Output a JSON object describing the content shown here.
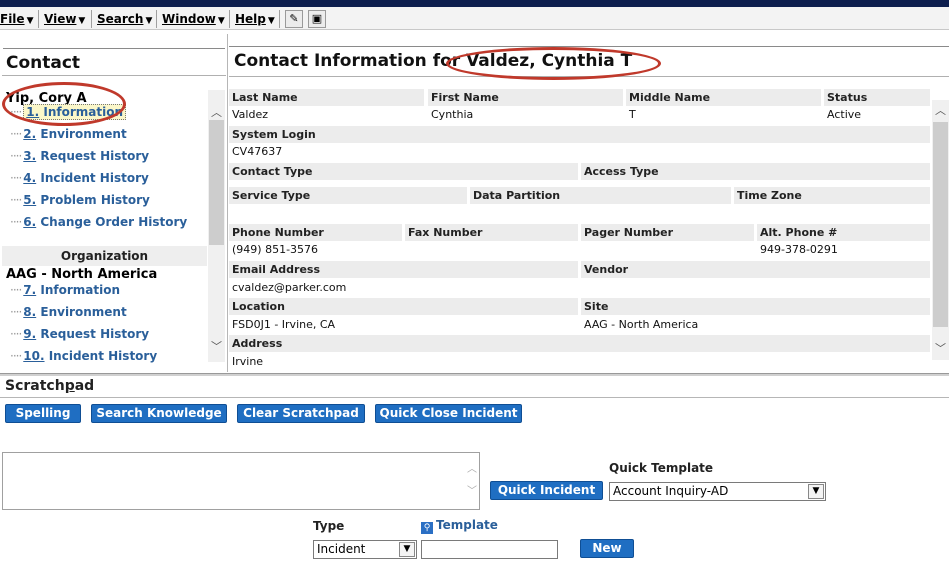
{
  "menu": {
    "file": "File",
    "view": "View",
    "search": "Search",
    "window": "Window",
    "help": "Help"
  },
  "left": {
    "title": "Contact",
    "contact_name": "Yip, Cory A",
    "contact_items": [
      {
        "num": "1.",
        "label": "Information"
      },
      {
        "num": "2.",
        "label": "Environment"
      },
      {
        "num": "3.",
        "label": "Request History"
      },
      {
        "num": "4.",
        "label": "Incident History"
      },
      {
        "num": "5.",
        "label": "Problem History"
      },
      {
        "num": "6.",
        "label": "Change Order History"
      }
    ],
    "org_header": "Organization",
    "org_name": "AAG - North America",
    "org_items": [
      {
        "num": "7.",
        "label": "Information"
      },
      {
        "num": "8.",
        "label": "Environment"
      },
      {
        "num": "9.",
        "label": "Request History"
      },
      {
        "num": "10.",
        "label": "Incident History"
      }
    ]
  },
  "right": {
    "title": "Contact Information for Valdez, Cynthia T",
    "fields": {
      "last_name_label": "Last Name",
      "last_name": "Valdez",
      "first_name_label": "First Name",
      "first_name": "Cynthia",
      "middle_name_label": "Middle Name",
      "middle_name": "T",
      "status_label": "Status",
      "status": "Active",
      "system_login_label": "System Login",
      "system_login": "CV47637",
      "contact_type_label": "Contact Type",
      "access_type_label": "Access Type",
      "service_type_label": "Service Type",
      "data_partition_label": "Data Partition",
      "time_zone_label": "Time Zone",
      "phone_label": "Phone Number",
      "phone": "(949) 851-3576",
      "fax_label": "Fax Number",
      "pager_label": "Pager Number",
      "alt_phone_label": "Alt. Phone #",
      "alt_phone": "949-378-0291",
      "email_label": "Email Address",
      "email": "cvaldez@parker.com",
      "vendor_label": "Vendor",
      "location_label": "Location",
      "location": "FSD0J1 - Irvine, CA",
      "site_label": "Site",
      "site": "AAG - North America",
      "address_label": "Address",
      "address": "Irvine"
    }
  },
  "scratchpad": {
    "title_a": "Scratch",
    "title_u": "p",
    "title_b": "ad",
    "spelling_button": "Spelling",
    "search_knowledge_button": "Search Knowledge",
    "clear_scratchpad_button": "Clear Scratchpad",
    "quick_close_incident_button": "Quick Close Incident",
    "quick_incident_button": "Quick Incident",
    "quick_template_label": "Quick Template",
    "quick_template_value": "Account Inquiry-AD",
    "type_label": "Type",
    "type_value": "Incident",
    "template_link": "Template",
    "new_button": "New"
  },
  "colors": {
    "button_blue": "#1f6ec2",
    "link_blue": "#2a5f9a",
    "annotation_red": "#c0392b"
  }
}
